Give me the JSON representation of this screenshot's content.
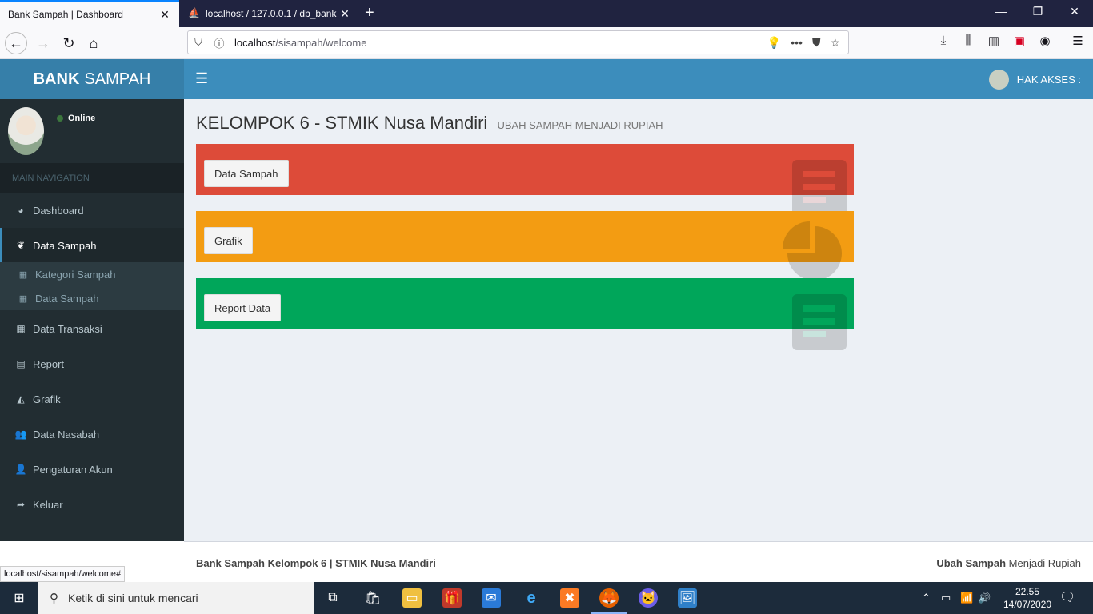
{
  "browser": {
    "tabs": [
      {
        "title": "Bank Sampah | Dashboard",
        "active": true
      },
      {
        "title": "localhost / 127.0.0.1 / db_bank",
        "active": false
      }
    ],
    "url_host": "localhost",
    "url_path": "/sisampah/welcome",
    "status_url": "localhost/sisampah/welcome#"
  },
  "header": {
    "logo_bold": "BANK",
    "logo_rest": "SAMPAH",
    "user_label": "HAK AKSES :"
  },
  "sidebar": {
    "status": "Online",
    "nav_header": "MAIN NAVIGATION",
    "items": [
      {
        "label": "Dashboard",
        "icon": "dashboard-icon"
      },
      {
        "label": "Data Sampah",
        "icon": "leaf-icon"
      },
      {
        "label": "Data Transaksi",
        "icon": "grid-icon"
      },
      {
        "label": "Report",
        "icon": "book-icon"
      },
      {
        "label": "Grafik",
        "icon": "area-chart-icon"
      },
      {
        "label": "Data Nasabah",
        "icon": "users-icon"
      },
      {
        "label": "Pengaturan Akun",
        "icon": "user-icon"
      },
      {
        "label": "Keluar",
        "icon": "share-icon"
      }
    ],
    "subitems": [
      {
        "label": "Kategori Sampah"
      },
      {
        "label": "Data Sampah"
      }
    ]
  },
  "content": {
    "title": "KELOMPOK 6 - STMIK Nusa Mandiri",
    "subtitle": "UBAH SAMPAH MENJADI RUPIAH",
    "boxes": [
      {
        "button": "Data Sampah",
        "color": "#dd4b39",
        "icon": "document-icon"
      },
      {
        "button": "Grafik",
        "color": "#f39c12",
        "icon": "pie-chart-icon"
      },
      {
        "button": "Report Data",
        "color": "#00a65a",
        "icon": "document-icon"
      }
    ]
  },
  "footer": {
    "left": "Bank Sampah Kelompok 6 | STMIK Nusa Mandiri",
    "right_bold": "Ubah Sampah",
    "right_rest": "Menjadi Rupiah"
  },
  "taskbar": {
    "search_placeholder": "Ketik di sini untuk mencari",
    "time": "22.55",
    "date": "14/07/2020"
  }
}
